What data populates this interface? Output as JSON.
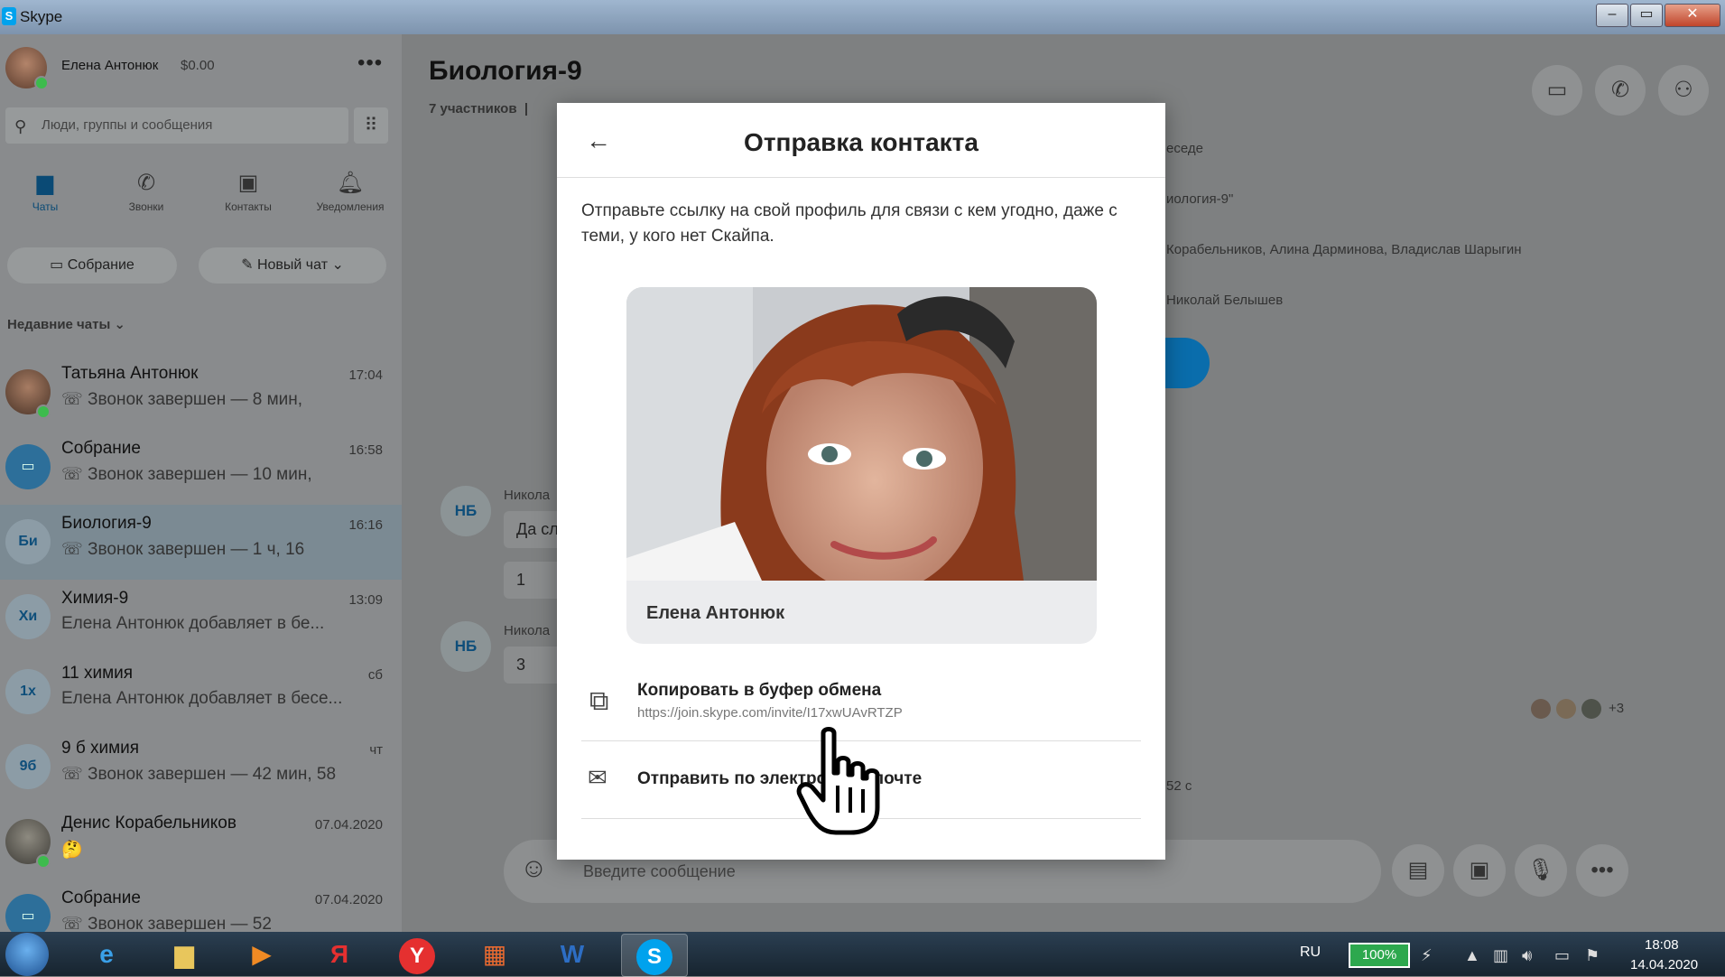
{
  "window": {
    "title": "Skype"
  },
  "profile": {
    "name": "Елена Антонюк",
    "balance": "$0.00"
  },
  "search": {
    "placeholder": "Люди, группы и сообщения"
  },
  "nav": [
    {
      "label": "Чаты",
      "icon": "chat-icon"
    },
    {
      "label": "Звонки",
      "icon": "phone-icon"
    },
    {
      "label": "Контакты",
      "icon": "contacts-icon"
    },
    {
      "label": "Уведомления",
      "icon": "bell-icon"
    }
  ],
  "actions": {
    "meeting": "Собрание",
    "new_chat": "Новый чат"
  },
  "recent_header": "Недавние чаты",
  "chats": [
    {
      "name": "Татьяна Антонюк",
      "time": "17:04",
      "preview": "Звонок завершен — 8 мин,",
      "avatar": ""
    },
    {
      "name": "Собрание",
      "time": "16:58",
      "preview": "Звонок завершен — 10 мин,",
      "avatar": ""
    },
    {
      "name": "Биология-9",
      "time": "16:16",
      "preview": "Звонок завершен — 1 ч, 16",
      "avatar": "Би"
    },
    {
      "name": "Химия-9",
      "time": "13:09",
      "preview": "Елена Антонюк добавляет в бе...",
      "avatar": "Хи"
    },
    {
      "name": "11 химия",
      "time": "сб",
      "preview": "Елена Антонюк добавляет в бесе...",
      "avatar": "1х"
    },
    {
      "name": "9 б химия",
      "time": "чт",
      "preview": "Звонок завершен — 42 мин, 58",
      "avatar": "9б"
    },
    {
      "name": "Денис Корабельников",
      "time": "07.04.2020",
      "preview": "🤔",
      "avatar": ""
    },
    {
      "name": "Собрание",
      "time": "07.04.2020",
      "preview": "Звонок завершен — 52",
      "avatar": ""
    }
  ],
  "conversation": {
    "title": "Биология-9",
    "participants": "7 участников",
    "bg_lines": [
      "еседе",
      "иология-9\"",
      "Корабельников, Алина Дарминова, Владислав Шарыгин",
      "Николай Белышев",
      "52 с"
    ],
    "bg_blue": "е",
    "messages": [
      {
        "initials": "НБ",
        "sender": "Никола",
        "text": "Да сл",
        "extra": "1"
      },
      {
        "initials": "НБ",
        "sender": "Никола",
        "text": "3",
        "extra": ""
      }
    ],
    "seen_more": "+3",
    "input_placeholder": "Введите сообщение"
  },
  "dialog": {
    "title": "Отправка контакта",
    "description": "Отправьте ссылку на свой профиль для связи с кем угодно, даже с теми, у кого нет Скайпа.",
    "card_name": "Елена Антонюк",
    "copy_label": "Копировать в буфер обмена",
    "copy_link": "https://join.skype.com/invite/I17xwUAvRTZP",
    "email_label": "Отправить по электронной почте"
  },
  "taskbar": {
    "lang": "RU",
    "battery": "100%",
    "time": "18:08",
    "date": "14.04.2020",
    "skype_letter": "S",
    "yandex_letter": "Я",
    "yabrowser_letter": "Y",
    "word_letter": "W"
  },
  "colors": {
    "accent": "#0a6dac",
    "online": "#3dbb4d"
  }
}
